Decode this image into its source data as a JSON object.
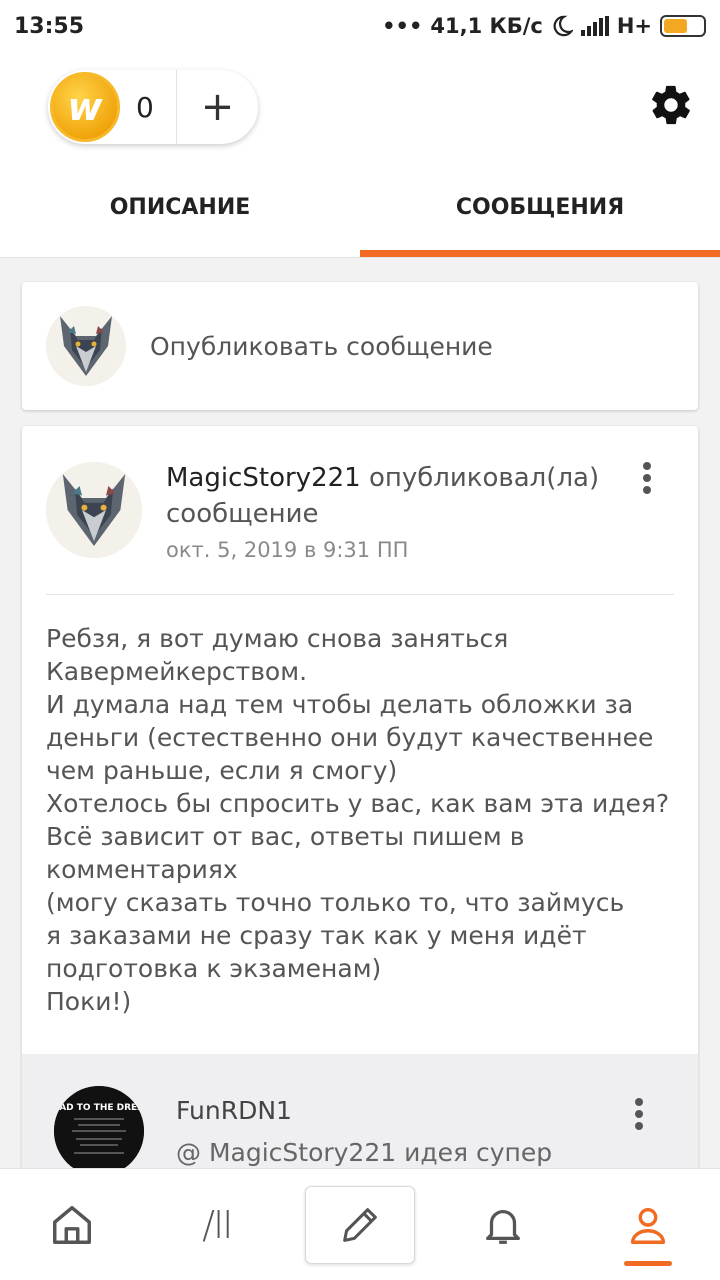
{
  "status_bar": {
    "time": "13:55",
    "network_speed": "41,1 КБ/с",
    "network_type": "H+",
    "dots": "•••"
  },
  "header": {
    "coin_logo_letter": "w",
    "coin_count": "0",
    "add_symbol": "+"
  },
  "tabs": [
    {
      "label": "ОПИСАНИЕ",
      "active": false
    },
    {
      "label": "СООБЩЕНИЯ",
      "active": true
    }
  ],
  "compose": {
    "placeholder": "Опубликовать сообщение"
  },
  "post": {
    "author": "MagicStory221",
    "action": "опубликовал(ла) сообщение",
    "date": "окт. 5, 2019 в 9:31 ПП",
    "body": "Ребзя, я вот думаю снова заняться\nКавермейкерством.\nИ думала над тем чтобы делать обложки за\nденьги (естественно они будут качественнее\nчем раньше, если я смогу)\nХотелось бы спросить у вас, как вам эта идея?\nВсё зависит от вас, ответы пишем в\nкомментариях\n(могу сказать точно только то, что займусь\nя заказами не сразу так как у меня идёт\nподготовка к экзаменам)\nПоки!)"
  },
  "comment": {
    "author": "FunRDN1",
    "text": "@ MagicStory221  идея супер",
    "avatar_text": "ROAD TO THE DREAM"
  },
  "bottom_nav": [
    {
      "name": "home",
      "icon": "home-icon"
    },
    {
      "name": "library",
      "icon": "library-icon",
      "glyph": "/II"
    },
    {
      "name": "write",
      "icon": "pencil-icon"
    },
    {
      "name": "notifications",
      "icon": "bell-icon"
    },
    {
      "name": "profile",
      "icon": "person-icon",
      "active": true
    }
  ],
  "colors": {
    "accent": "#f26b23",
    "coin": "#f3a823"
  }
}
